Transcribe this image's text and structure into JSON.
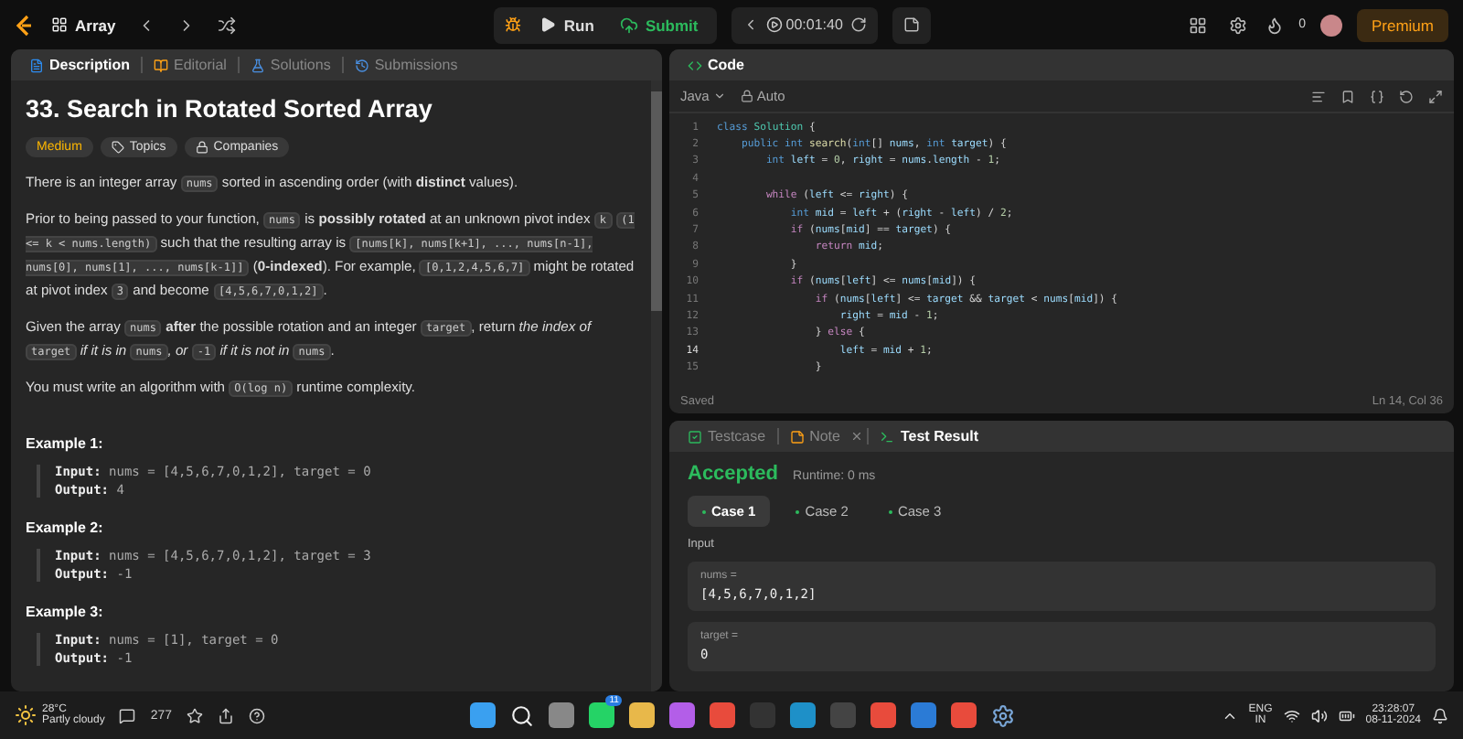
{
  "topbar": {
    "problem_list": "Array",
    "run": "Run",
    "submit": "Submit",
    "timer": "00:01:40",
    "streak": "0",
    "premium": "Premium"
  },
  "description": {
    "tabs": [
      {
        "label": "Description",
        "selected": true
      },
      {
        "label": "Editorial",
        "selected": false
      },
      {
        "label": "Solutions",
        "selected": false
      },
      {
        "label": "Submissions",
        "selected": false
      }
    ],
    "title": "33. Search in Rotated Sorted Array",
    "difficulty": "Medium",
    "tags": [
      "Topics",
      "Companies"
    ],
    "paragraphs": [
      [
        {
          "kind": "text",
          "text": "There is an integer array "
        },
        {
          "kind": "code",
          "text": "nums"
        },
        {
          "kind": "text",
          "text": " sorted in ascending order (with **distinct** values)."
        }
      ],
      [
        {
          "kind": "text",
          "text": "Prior to being passed to your function, "
        },
        {
          "kind": "code",
          "text": "nums"
        },
        {
          "kind": "text",
          "text": " is **possibly rotated** at an unknown pivot index "
        },
        {
          "kind": "code",
          "text": "k"
        },
        {
          "kind": "code",
          "text": "(1 <= k < nums.length)"
        },
        {
          "kind": "text",
          "text": " such that the resulting array is "
        },
        {
          "kind": "code",
          "text": "[nums[k], nums[k+1], ..., nums[n-1], nums[0], nums[1], ..., nums[k-1]]"
        },
        {
          "kind": "text",
          "text": " (**0-indexed**). For example, "
        },
        {
          "kind": "code",
          "text": "[0,1,2,4,5,6,7]"
        },
        {
          "kind": "text",
          "text": " might be rotated at pivot index "
        },
        {
          "kind": "code",
          "text": "3"
        },
        {
          "kind": "text",
          "text": " and become "
        },
        {
          "kind": "code",
          "text": "[4,5,6,7,0,1,2]"
        },
        {
          "kind": "text",
          "text": "."
        }
      ],
      [
        {
          "kind": "text",
          "text": "Given the array "
        },
        {
          "kind": "code",
          "text": "nums"
        },
        {
          "kind": "text",
          "text": " **after** the possible rotation and an integer "
        },
        {
          "kind": "code",
          "text": "target"
        },
        {
          "kind": "text",
          "text": ", return *the index of* "
        },
        {
          "kind": "code",
          "text": "target"
        },
        {
          "kind": "text",
          "text": " *if it is in* "
        },
        {
          "kind": "code",
          "text": "nums"
        },
        {
          "kind": "text",
          "text": "*, or* "
        },
        {
          "kind": "code",
          "text": "-1"
        },
        {
          "kind": "text",
          "text": " *if it is not in* "
        },
        {
          "kind": "code",
          "text": "nums"
        },
        {
          "kind": "text",
          "text": "."
        }
      ],
      [
        {
          "kind": "text",
          "text": "You must write an algorithm with "
        },
        {
          "kind": "code",
          "text": "O(log n)"
        },
        {
          "kind": "text",
          "text": " runtime complexity."
        }
      ]
    ],
    "examples": [
      {
        "title": "Example 1:",
        "input_label": "Input:",
        "input": "nums = [4,5,6,7,0,1,2], target = 0",
        "output_label": "Output:",
        "output": "4"
      },
      {
        "title": "Example 2:",
        "input_label": "Input:",
        "input": "nums = [4,5,6,7,0,1,2], target = 3",
        "output_label": "Output:",
        "output": "-1"
      },
      {
        "title": "Example 3:",
        "input_label": "Input:",
        "input": "nums = [1], target = 0",
        "output_label": "Output:",
        "output": "-1"
      }
    ]
  },
  "editor": {
    "tab": "Code",
    "language": "Java",
    "mode": "Auto",
    "lines": [
      {
        "n": "1",
        "current": false,
        "tokens": [
          {
            "kind": "keyword",
            "text": "class "
          },
          {
            "kind": "type",
            "text": "Solution"
          },
          {
            "kind": "plain",
            "text": " {"
          }
        ]
      },
      {
        "n": "2",
        "current": false,
        "tokens": [
          {
            "kind": "keyword",
            "text": "    public int "
          },
          {
            "kind": "function",
            "text": "search"
          },
          {
            "kind": "plain",
            "text": "("
          },
          {
            "kind": "keyword",
            "text": "int"
          },
          {
            "kind": "plain",
            "text": "[] "
          },
          {
            "kind": "variable",
            "text": "nums"
          },
          {
            "kind": "plain",
            "text": ", "
          },
          {
            "kind": "keyword",
            "text": "int "
          },
          {
            "kind": "variable",
            "text": "target"
          },
          {
            "kind": "plain",
            "text": ") {"
          }
        ]
      },
      {
        "n": "3",
        "current": false,
        "tokens": [
          {
            "kind": "keyword",
            "text": "        int "
          },
          {
            "kind": "variable",
            "text": "left"
          },
          {
            "kind": "plain",
            "text": " = "
          },
          {
            "kind": "number",
            "text": "0"
          },
          {
            "kind": "plain",
            "text": ", "
          },
          {
            "kind": "variable",
            "text": "right"
          },
          {
            "kind": "plain",
            "text": " = "
          },
          {
            "kind": "variable",
            "text": "nums"
          },
          {
            "kind": "plain",
            "text": "."
          },
          {
            "kind": "variable",
            "text": "length"
          },
          {
            "kind": "plain",
            "text": " - "
          },
          {
            "kind": "number",
            "text": "1"
          },
          {
            "kind": "plain",
            "text": ";"
          }
        ]
      },
      {
        "n": "4",
        "current": false
      },
      {
        "n": "5",
        "current": false,
        "tokens": [
          {
            "kind": "control",
            "text": "        while "
          },
          {
            "kind": "plain",
            "text": "("
          },
          {
            "kind": "variable",
            "text": "left"
          },
          {
            "kind": "plain",
            "text": " <= "
          },
          {
            "kind": "variable",
            "text": "right"
          },
          {
            "kind": "plain",
            "text": ") {"
          }
        ]
      },
      {
        "n": "6",
        "current": false,
        "tokens": [
          {
            "kind": "keyword",
            "text": "            int "
          },
          {
            "kind": "variable",
            "text": "mid"
          },
          {
            "kind": "plain",
            "text": " = "
          },
          {
            "kind": "variable",
            "text": "left"
          },
          {
            "kind": "plain",
            "text": " + ("
          },
          {
            "kind": "variable",
            "text": "right"
          },
          {
            "kind": "plain",
            "text": " - "
          },
          {
            "kind": "variable",
            "text": "left"
          },
          {
            "kind": "plain",
            "text": ") / "
          },
          {
            "kind": "number",
            "text": "2"
          },
          {
            "kind": "plain",
            "text": ";"
          }
        ]
      },
      {
        "n": "7",
        "current": false,
        "tokens": [
          {
            "kind": "control",
            "text": "            if "
          },
          {
            "kind": "plain",
            "text": "("
          },
          {
            "kind": "variable",
            "text": "nums"
          },
          {
            "kind": "plain",
            "text": "["
          },
          {
            "kind": "variable",
            "text": "mid"
          },
          {
            "kind": "plain",
            "text": "] == "
          },
          {
            "kind": "variable",
            "text": "target"
          },
          {
            "kind": "plain",
            "text": ") {"
          }
        ]
      },
      {
        "n": "8",
        "current": false,
        "tokens": [
          {
            "kind": "control",
            "text": "                return "
          },
          {
            "kind": "variable",
            "text": "mid"
          },
          {
            "kind": "plain",
            "text": ";"
          }
        ]
      },
      {
        "n": "9",
        "current": false,
        "tokens": [
          {
            "kind": "plain",
            "text": "            }"
          }
        ]
      },
      {
        "n": "10",
        "current": false,
        "tokens": [
          {
            "kind": "control",
            "text": "            if "
          },
          {
            "kind": "plain",
            "text": "("
          },
          {
            "kind": "variable",
            "text": "nums"
          },
          {
            "kind": "plain",
            "text": "["
          },
          {
            "kind": "variable",
            "text": "left"
          },
          {
            "kind": "plain",
            "text": "] <= "
          },
          {
            "kind": "variable",
            "text": "nums"
          },
          {
            "kind": "plain",
            "text": "["
          },
          {
            "kind": "variable",
            "text": "mid"
          },
          {
            "kind": "plain",
            "text": "]) {"
          }
        ]
      },
      {
        "n": "11",
        "current": false,
        "tokens": [
          {
            "kind": "control",
            "text": "                if "
          },
          {
            "kind": "plain",
            "text": "("
          },
          {
            "kind": "variable",
            "text": "nums"
          },
          {
            "kind": "plain",
            "text": "["
          },
          {
            "kind": "variable",
            "text": "left"
          },
          {
            "kind": "plain",
            "text": "] <= "
          },
          {
            "kind": "variable",
            "text": "target"
          },
          {
            "kind": "plain",
            "text": " && "
          },
          {
            "kind": "variable",
            "text": "target"
          },
          {
            "kind": "plain",
            "text": " < "
          },
          {
            "kind": "variable",
            "text": "nums"
          },
          {
            "kind": "plain",
            "text": "["
          },
          {
            "kind": "variable",
            "text": "mid"
          },
          {
            "kind": "plain",
            "text": "]) {"
          }
        ]
      },
      {
        "n": "12",
        "current": false,
        "tokens": [
          {
            "kind": "variable",
            "text": "                    right"
          },
          {
            "kind": "plain",
            "text": " = "
          },
          {
            "kind": "variable",
            "text": "mid"
          },
          {
            "kind": "plain",
            "text": " - "
          },
          {
            "kind": "number",
            "text": "1"
          },
          {
            "kind": "plain",
            "text": ";"
          }
        ]
      },
      {
        "n": "13",
        "current": false,
        "tokens": [
          {
            "kind": "plain",
            "text": "                } "
          },
          {
            "kind": "control",
            "text": "else"
          },
          {
            "kind": "plain",
            "text": " {"
          }
        ]
      },
      {
        "n": "14",
        "current": true,
        "tokens": [
          {
            "kind": "variable",
            "text": "                    left"
          },
          {
            "kind": "plain",
            "text": " = "
          },
          {
            "kind": "variable",
            "text": "mid"
          },
          {
            "kind": "plain",
            "text": " + "
          },
          {
            "kind": "number",
            "text": "1"
          },
          {
            "kind": "plain",
            "text": ";"
          }
        ]
      },
      {
        "n": "15",
        "current": false,
        "tokens": [
          {
            "kind": "plain",
            "text": "                }"
          }
        ]
      }
    ],
    "status": "Saved",
    "cursor": "Ln 14, Col 36"
  },
  "test": {
    "tabs": [
      {
        "label": "Testcase",
        "selected": false,
        "kind": "testcase"
      },
      {
        "label": "Note",
        "selected": false,
        "kind": "note"
      },
      {
        "label": "Test Result",
        "selected": true,
        "kind": "result"
      }
    ],
    "verdict": "Accepted",
    "runtime": "Runtime: 0 ms",
    "cases": [
      {
        "label": "Case 1",
        "selected": true
      },
      {
        "label": "Case 2",
        "selected": false
      },
      {
        "label": "Case 3",
        "selected": false
      }
    ],
    "input_heading": "Input",
    "fields": [
      {
        "label": "nums =",
        "value": "[4,5,6,7,0,1,2]"
      },
      {
        "label": "target =",
        "value": "0"
      }
    ]
  },
  "taskbar": {
    "temperature": "28°C",
    "weather": "Partly cloudy",
    "comments": "277",
    "whatsapp_badge": "11",
    "language": "ENG",
    "region": "IN",
    "time": "23:28:07",
    "date": "08-11-2024"
  }
}
